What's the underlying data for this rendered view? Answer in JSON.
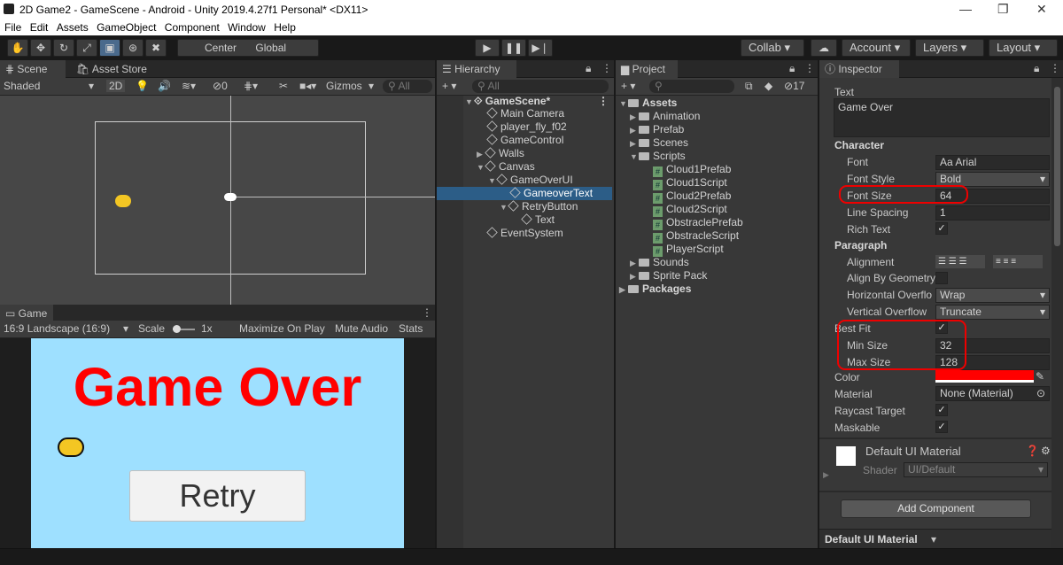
{
  "window": {
    "title": "2D Game2 - GameScene - Android - Unity 2019.4.27f1 Personal* <DX11>",
    "min": "—",
    "max": "❐",
    "close": "✕"
  },
  "menu": [
    "File",
    "Edit",
    "Assets",
    "GameObject",
    "Component",
    "Window",
    "Help"
  ],
  "toolbar": {
    "center": "Center",
    "global": "Global",
    "collab": "Collab",
    "account": "Account",
    "layers": "Layers",
    "layout": "Layout"
  },
  "scene": {
    "tab": "Scene",
    "tab2": "Asset Store",
    "shading": "Shaded",
    "mode2d": "2D",
    "gizmos": "Gizmos",
    "search": "All",
    "hidden_count": "0"
  },
  "game": {
    "tab": "Game",
    "aspect": "16:9 Landscape (16:9)",
    "scale_label": "Scale",
    "scale_value": "1x",
    "maximize": "Maximize On Play",
    "mute": "Mute Audio",
    "stats": "Stats",
    "title_text": "Game Over",
    "retry": "Retry",
    "colors": {
      "bg": "#9ee0ff",
      "title": "#ff0000"
    }
  },
  "hierarchy": {
    "tab": "Hierarchy",
    "search": "All",
    "scene": "GameScene*",
    "items": [
      {
        "label": "Main Camera"
      },
      {
        "label": "player_fly_f02"
      },
      {
        "label": "GameControl"
      },
      {
        "label": "Walls"
      },
      {
        "label": "Canvas"
      },
      {
        "label": "GameOverUI"
      },
      {
        "label": "GameoverText"
      },
      {
        "label": "RetryButton"
      },
      {
        "label": "Text"
      },
      {
        "label": "EventSystem"
      }
    ]
  },
  "project": {
    "tab": "Project",
    "hidden_count": "17",
    "assets": "Assets",
    "folders": [
      "Animation",
      "Prefab",
      "Scenes",
      "Scripts"
    ],
    "scripts": [
      "Cloud1Prefab",
      "Cloud1Script",
      "Cloud2Prefab",
      "Cloud2Script",
      "ObstraclePrefab",
      "ObstracleScript",
      "PlayerScript"
    ],
    "folders2": [
      "Sounds",
      "Sprite Pack"
    ],
    "packages": "Packages"
  },
  "inspector": {
    "tab": "Inspector",
    "text_label": "Text",
    "text_value": "Game Over",
    "character": "Character",
    "font_label": "Font",
    "font_value": "Arial",
    "fontstyle_label": "Font Style",
    "fontstyle_value": "Bold",
    "fontsize_label": "Font Size",
    "fontsize_value": "64",
    "linespacing_label": "Line Spacing",
    "linespacing_value": "1",
    "richtext_label": "Rich Text",
    "paragraph": "Paragraph",
    "alignment_label": "Alignment",
    "alignbygeo_label": "Align By Geometry",
    "hoverflow_label": "Horizontal Overflo",
    "hoverflow_value": "Wrap",
    "voverflow_label": "Vertical Overflow",
    "voverflow_value": "Truncate",
    "bestfit_label": "Best Fit",
    "minsize_label": "Min Size",
    "minsize_value": "32",
    "maxsize_label": "Max Size",
    "maxsize_value": "128",
    "color_label": "Color",
    "color_value": "#ff0000",
    "material_label": "Material",
    "material_value": "None (Material)",
    "raycast_label": "Raycast Target",
    "maskable_label": "Maskable",
    "mat_title": "Default UI Material",
    "shader_label": "Shader",
    "shader_value": "UI/Default",
    "add_component": "Add Component",
    "footer": "Default UI Material"
  }
}
